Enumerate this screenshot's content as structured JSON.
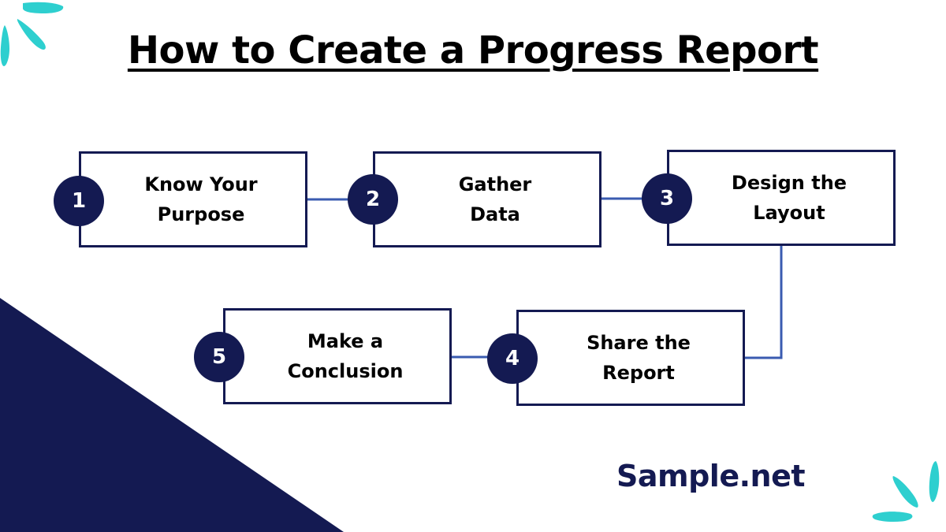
{
  "title": "How to Create a Progress Report",
  "steps": [
    {
      "number": "1",
      "label": "Know Your Purpose"
    },
    {
      "number": "2",
      "label": "Gather Data"
    },
    {
      "number": "3",
      "label": "Design the Layout"
    },
    {
      "number": "4",
      "label": "Share the Report"
    },
    {
      "number": "5",
      "label": "Make a Conclusion"
    }
  ],
  "brand": "Sample.net",
  "colors": {
    "navy": "#141a52",
    "connector": "#3a5bb0",
    "accent_teal": "#2ecfcf",
    "text": "#000000",
    "background": "#ffffff"
  }
}
